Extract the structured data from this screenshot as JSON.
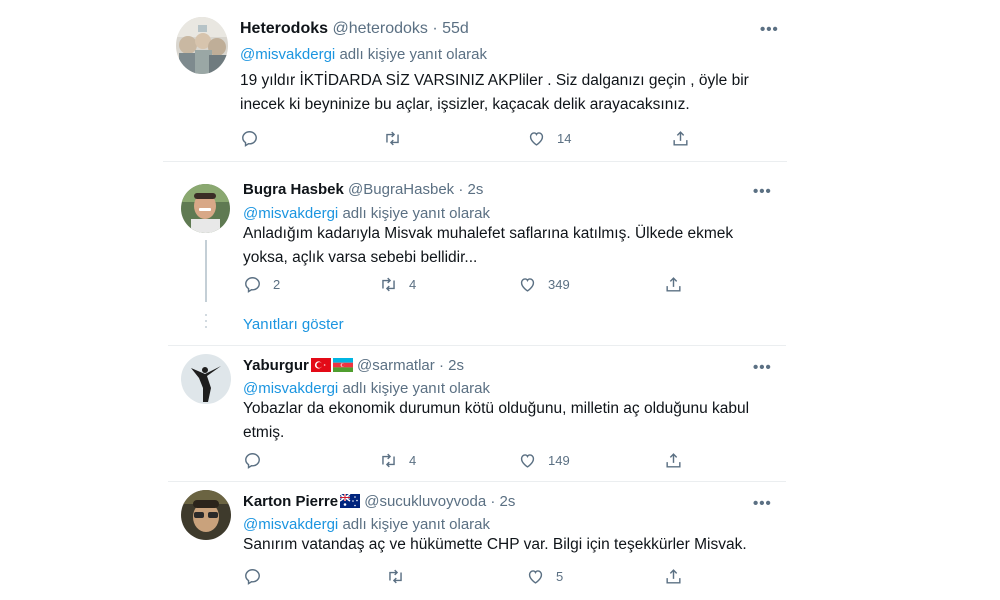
{
  "reply_prefix_suffix": "adlı kişiye yanıt olarak",
  "tweets": [
    {
      "name": "Heterodoks",
      "handle": "@heterodoks",
      "time": "55d",
      "mention": "@misvakdergi",
      "text_lines": [
        "19 yıldır İKTİDARDA SİZ VARSINIZ AKPliler . Siz dalganızı geçin ,  öyle bir",
        "inecek ki beyninize bu açlar, işsizler, kaçacak delik arayacaksınız."
      ],
      "replies": "",
      "retweets": "",
      "likes": "14"
    },
    {
      "name": "Bugra Hasbek",
      "handle": "@BugraHasbek",
      "time": "2s",
      "mention": "@misvakdergi",
      "text_lines": [
        "Anladığım kadarıyla Misvak muhalefet saflarına katılmış. Ülkede ekmek",
        "yoksa, açlık varsa sebebi bellidir..."
      ],
      "replies": "2",
      "retweets": "4",
      "likes": "349",
      "show_replies": "Yanıtları göster"
    },
    {
      "name": "Yaburgur",
      "handle": "@sarmatlar",
      "time": "2s",
      "mention": "@misvakdergi",
      "text_lines": [
        "Yobazlar da ekonomik durumun kötü olduğunu, milletin aç olduğunu kabul",
        "etmiş."
      ],
      "replies": "",
      "retweets": "4",
      "likes": "149"
    },
    {
      "name": "Karton Pierre",
      "handle": "@sucukluvoyvoda",
      "time": "2s",
      "mention": "@misvakdergi",
      "text_lines": [
        "Sanırım vatandaş aç ve hükümette CHP var. Bilgi için teşekkürler Misvak."
      ],
      "replies": "",
      "retweets": "",
      "likes": "5"
    }
  ],
  "dot_separator": "·",
  "more_glyph": "•••"
}
